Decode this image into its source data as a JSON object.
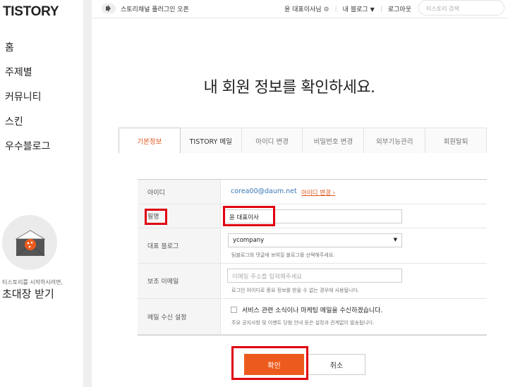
{
  "sidebar": {
    "logo": "TISTORY",
    "nav": [
      "홈",
      "주제별",
      "커뮤니티",
      "스킨",
      "우수블로그"
    ],
    "invite_sub": "티스토리를 시작하시려면,",
    "invite_main": "초대장 받기"
  },
  "topbar": {
    "notice": "스토리채널 플러그인 오픈",
    "user": "윤 대표이사님",
    "my_blog": "내 블로그",
    "logout": "로그아웃",
    "search_placeholder": "티스토리 검색"
  },
  "page": {
    "title": "내 회원 정보를 확인하세요."
  },
  "tabs": [
    {
      "label": "기본정보",
      "active": true
    },
    {
      "label": "TISTORY 메일"
    },
    {
      "label": "아이디 변경"
    },
    {
      "label": "비밀번호 변경"
    },
    {
      "label": "외부기능관리"
    },
    {
      "label": "회원탈퇴"
    }
  ],
  "form": {
    "id_label": "아이디",
    "id_value": "corea00@daum.net",
    "id_change_link": "아이디 변경 ›",
    "nick_label": "필명",
    "nick_value": "윤 대표이사",
    "blog_label": "대표 블로그",
    "blog_value": "ycompany",
    "blog_hint": "팀블로그와 댓글에 보여질 블로그를 선택해주세요.",
    "subemail_label": "보조 이메일",
    "subemail_placeholder": "이메일 주소를 입력해주세요",
    "subemail_hint": "로그인 아이디로 중요 정보를 받을 수 없는 경우에 사용됩니다.",
    "mail_label": "메일 수신 설정",
    "mail_check": "서비스 관련 소식이나 마케팅 메일을 수신하겠습니다.",
    "mail_hint": "주요 공지사항 및 이벤트 당첨 안내 등은 설정과 관계없이 발송됩니다."
  },
  "buttons": {
    "confirm": "확인",
    "cancel": "취소"
  },
  "colors": {
    "accent": "#ec5b1d",
    "highlight": "#e0000f",
    "link": "#3a78b5"
  }
}
